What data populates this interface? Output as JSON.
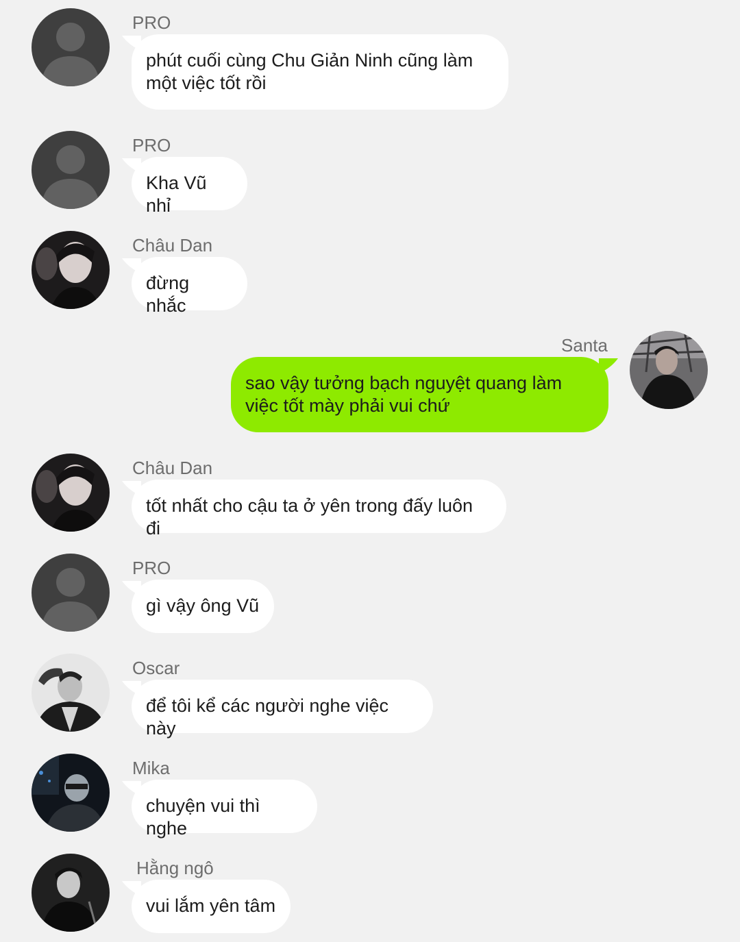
{
  "colors": {
    "background": "#f1f1f1",
    "incoming_bubble": "#ffffff",
    "outgoing_bubble": "#8eea00",
    "sender_text": "#6d6d6d",
    "message_text": "#1c1c1c"
  },
  "messages": [
    {
      "sender": "PRO",
      "text": "phút cuối cùng Chu Giản Ninh cũng làm một việc tốt rồi",
      "direction": "incoming",
      "avatar": "default-person-icon"
    },
    {
      "sender": "PRO",
      "text": "Kha Vũ nhỉ",
      "direction": "incoming",
      "avatar": "default-person-icon"
    },
    {
      "sender": "Châu Dan",
      "text": "đừng nhắc",
      "direction": "incoming",
      "avatar": "user-photo-avatar"
    },
    {
      "sender": "Santa",
      "text": "sao vậy tưởng bạch nguyệt quang làm việc tốt mày phải vui chứ",
      "direction": "outgoing",
      "avatar": "user-photo-avatar"
    },
    {
      "sender": "Châu Dan",
      "text": "tốt nhất cho cậu ta ở yên trong đấy luôn đi",
      "direction": "incoming",
      "avatar": "user-photo-avatar"
    },
    {
      "sender": "PRO",
      "text": "gì vậy ông Vũ",
      "direction": "incoming",
      "avatar": "default-person-icon"
    },
    {
      "sender": "Oscar",
      "text": "để tôi kể các người nghe việc này",
      "direction": "incoming",
      "avatar": "user-photo-avatar"
    },
    {
      "sender": "Mika",
      "text": "chuyện vui thì nghe",
      "direction": "incoming",
      "avatar": "user-photo-avatar"
    },
    {
      "sender": "Hằng ngô",
      "text": "vui lắm yên tâm",
      "direction": "incoming",
      "avatar": "user-photo-avatar"
    }
  ]
}
